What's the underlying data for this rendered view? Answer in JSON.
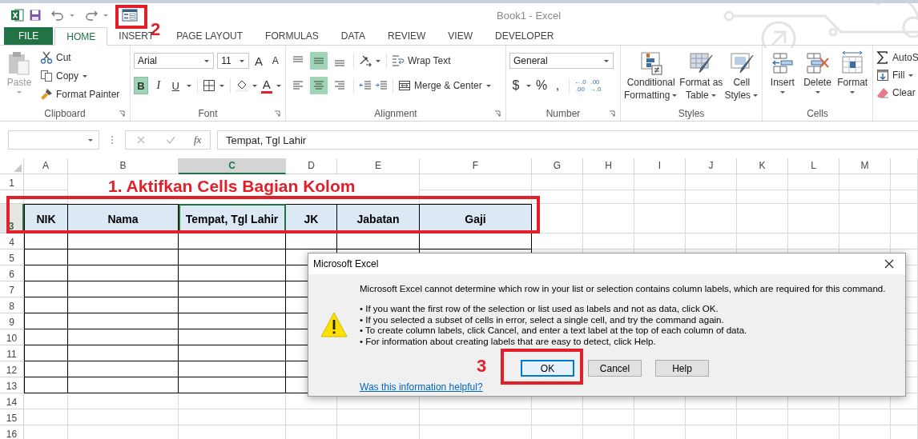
{
  "window": {
    "title": "Book1 - Excel"
  },
  "quick_access": {
    "step_label": "2"
  },
  "tabs": [
    {
      "label": "FILE",
      "kind": "file",
      "selected": false
    },
    {
      "label": "HOME",
      "kind": "tab",
      "selected": true
    },
    {
      "label": "INSERT",
      "kind": "tab",
      "selected": false
    },
    {
      "label": "PAGE LAYOUT",
      "kind": "tab",
      "selected": false
    },
    {
      "label": "FORMULAS",
      "kind": "tab",
      "selected": false
    },
    {
      "label": "DATA",
      "kind": "tab",
      "selected": false
    },
    {
      "label": "REVIEW",
      "kind": "tab",
      "selected": false
    },
    {
      "label": "VIEW",
      "kind": "tab",
      "selected": false
    },
    {
      "label": "DEVELOPER",
      "kind": "tab",
      "selected": false
    }
  ],
  "clipboard": {
    "title": "Clipboard",
    "paste": "Paste",
    "cut": "Cut",
    "copy": "Copy",
    "format_painter": "Format Painter"
  },
  "font": {
    "title": "Font",
    "name": "Arial",
    "size": "11",
    "grow": "A",
    "shrink": "A",
    "font_color": "A",
    "styles": [
      {
        "label": "B",
        "kind": "bold",
        "on": true
      },
      {
        "label": "I",
        "kind": "italic",
        "on": false
      },
      {
        "label": "U",
        "kind": "underline",
        "on": false
      }
    ]
  },
  "alignment": {
    "title": "Alignment",
    "wrap_text": "Wrap Text",
    "merge_center": "Merge & Center",
    "vertical": [
      {
        "kind": "top",
        "on": false
      },
      {
        "kind": "middle",
        "on": true
      },
      {
        "kind": "bottom",
        "on": false
      }
    ],
    "horizontal": [
      {
        "kind": "left",
        "on": false
      },
      {
        "kind": "center",
        "on": true
      },
      {
        "kind": "right",
        "on": false
      }
    ]
  },
  "number": {
    "title": "Number",
    "format": "General",
    "symbols": [
      "$",
      "%",
      ","
    ],
    "decimals": [
      {
        "top": "←.0",
        "bottom": ".00"
      },
      {
        "top": ".00",
        "bottom": "→.0"
      }
    ]
  },
  "styles": {
    "title": "Styles",
    "buttons": [
      {
        "kind": "conditional",
        "lines": [
          "Conditional",
          "Formatting"
        ]
      },
      {
        "kind": "table",
        "lines": [
          "Format as",
          "Table"
        ]
      },
      {
        "kind": "cell",
        "lines": [
          "Cell",
          "Styles"
        ]
      }
    ]
  },
  "cells": {
    "title": "Cells",
    "buttons": [
      {
        "kind": "insert",
        "label": "Insert"
      },
      {
        "kind": "delete",
        "label": "Delete"
      },
      {
        "kind": "format",
        "label": "Format"
      }
    ]
  },
  "editing": {
    "items": [
      {
        "kind": "autosum",
        "label": "AutoS"
      },
      {
        "kind": "fill",
        "label": "Fill"
      },
      {
        "kind": "clear",
        "label": "Clear"
      }
    ]
  },
  "formula_bar": {
    "function_label": "fx",
    "value": "Tempat, Tgl Lahir"
  },
  "sheet": {
    "caption": "1. Aktifkan Cells Bagian Kolom",
    "columns": [
      {
        "label": "A",
        "selected": false
      },
      {
        "label": "B",
        "selected": false
      },
      {
        "label": "C",
        "selected": true
      },
      {
        "label": "D",
        "selected": false
      },
      {
        "label": "E",
        "selected": false
      },
      {
        "label": "F",
        "selected": false
      },
      {
        "label": "G",
        "selected": false
      },
      {
        "label": "H",
        "selected": false
      },
      {
        "label": "I",
        "selected": false
      },
      {
        "label": "J",
        "selected": false
      },
      {
        "label": "K",
        "selected": false
      },
      {
        "label": "L",
        "selected": false
      },
      {
        "label": "M",
        "selected": false
      }
    ],
    "headers": [
      {
        "text": "NIK",
        "selected": false
      },
      {
        "text": "Nama",
        "selected": false
      },
      {
        "text": "Tempat, Tgl Lahir",
        "selected": true
      },
      {
        "text": "JK",
        "selected": false
      },
      {
        "text": "Jabatan",
        "selected": false
      },
      {
        "text": "Gaji",
        "selected": false
      }
    ],
    "rows": [
      {
        "label": "1",
        "kind": "caption",
        "selected": false
      },
      {
        "kind": "caption",
        "selected": false
      },
      {
        "label": "3",
        "kind": "header",
        "selected": true
      },
      {
        "label": "4",
        "kind": "body",
        "selected": false
      },
      {
        "label": "5",
        "kind": "body",
        "selected": false
      },
      {
        "label": "6",
        "kind": "body",
        "selected": false
      },
      {
        "label": "7",
        "kind": "body",
        "selected": false
      },
      {
        "label": "8",
        "kind": "body",
        "selected": false
      },
      {
        "label": "9",
        "kind": "body",
        "selected": false
      },
      {
        "label": "10",
        "kind": "body",
        "selected": false
      },
      {
        "label": "11",
        "kind": "body",
        "selected": false
      },
      {
        "label": "12",
        "kind": "body",
        "selected": false
      },
      {
        "label": "13",
        "kind": "body",
        "selected": false
      },
      {
        "label": "14",
        "kind": "blank",
        "selected": false
      },
      {
        "label": "15",
        "kind": "blank",
        "selected": false
      },
      {
        "label": "16",
        "kind": "blank",
        "selected": false
      }
    ]
  },
  "dialog": {
    "title": "Microsoft Excel",
    "message": "Microsoft Excel cannot determine which row in your list or selection contains column labels, which are required for this command.",
    "bullets": [
      "• If you want the first row of the selection or list used as labels and not as data, click OK.",
      "• If you selected a subset of cells in error, select a single cell, and try the command again.",
      "• To create column labels, click Cancel, and enter a text label at the top of each column of data.",
      "• For information about creating labels that are easy to detect, click Help."
    ],
    "step_label": "3",
    "buttons": [
      {
        "label": "OK",
        "selected": true
      },
      {
        "label": "Cancel",
        "selected": false
      },
      {
        "label": "Help",
        "selected": false
      }
    ],
    "link": "Was this information helpful?"
  }
}
